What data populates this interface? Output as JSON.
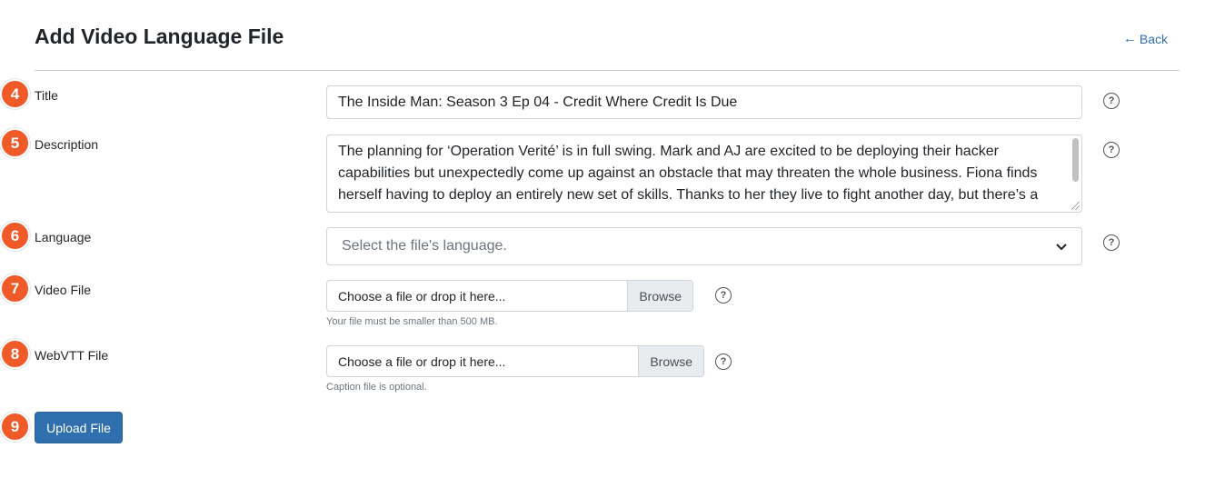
{
  "header": {
    "title": "Add Video Language File",
    "back_arrow": "←",
    "back_label": "Back"
  },
  "steps": [
    "4",
    "5",
    "6",
    "7",
    "8",
    "9"
  ],
  "form": {
    "title": {
      "label": "Title",
      "value": "The Inside Man: Season 3 Ep 04 - Credit Where Credit Is Due"
    },
    "description": {
      "label": "Description",
      "value": "The planning for ‘Operation Verité’ is in full swing. Mark and AJ are excited to be deploying their hacker capabilities but unexpectedly come up against an obstacle that may threaten the whole business. Fiona finds herself having to deploy an entirely new set of skills. Thanks to her they live to fight another day, but there’s a"
    },
    "language": {
      "label": "Language",
      "placeholder": "Select the file's language."
    },
    "video_file": {
      "label": "Video File",
      "placeholder": "Choose a file or drop it here...",
      "browse_label": "Browse",
      "help": "Your file must be smaller than 500 MB."
    },
    "webvtt_file": {
      "label": "WebVTT File",
      "placeholder": "Choose a file or drop it here...",
      "browse_label": "Browse",
      "help": "Caption file is optional."
    },
    "help_glyph": "?",
    "select_chevron": "⌄",
    "submit_label": "Upload File"
  },
  "colors": {
    "step_badge": "#f05a28",
    "primary_button": "#2f6fad",
    "link": "#2f6fad"
  }
}
